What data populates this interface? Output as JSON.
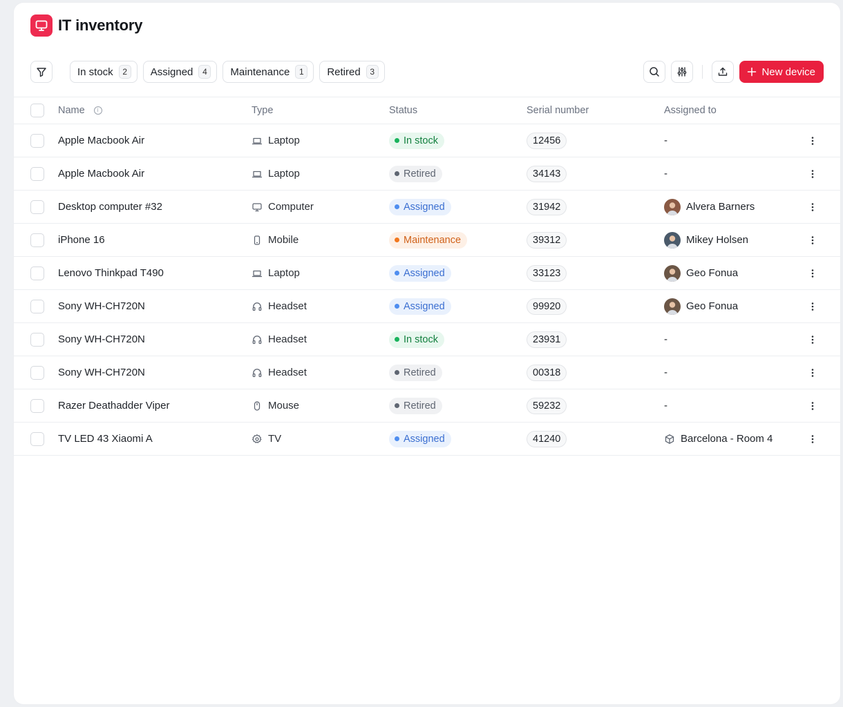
{
  "app": {
    "title": "IT inventory"
  },
  "filters": [
    {
      "label": "In stock",
      "count": "2"
    },
    {
      "label": "Assigned",
      "count": "4"
    },
    {
      "label": "Maintenance",
      "count": "1"
    },
    {
      "label": "Retired",
      "count": "3"
    }
  ],
  "toolbar": {
    "new_device_label": "New device"
  },
  "colors": {
    "accent": "#e9203f",
    "in_stock": {
      "bg": "#e7f7ee",
      "fg": "#13803f",
      "dot": "#19b35c"
    },
    "retired": {
      "bg": "#f0f1f3",
      "fg": "#5f6672",
      "dot": "#5f6672"
    },
    "assigned": {
      "bg": "#e9f1fd",
      "fg": "#3b6fd1",
      "dot": "#4f8ef0"
    },
    "maintenance": {
      "bg": "#fdf0e6",
      "fg": "#d0621a",
      "dot": "#f2781f"
    }
  },
  "table": {
    "columns": [
      "Name",
      "Type",
      "Status",
      "Serial number",
      "Assigned to"
    ],
    "rows": [
      {
        "name": "Apple Macbook Air",
        "type": "Laptop",
        "type_icon": "laptop-icon",
        "status": "In stock",
        "status_key": "in_stock",
        "serial": "12456",
        "assigned": "-",
        "assigned_kind": "none"
      },
      {
        "name": "Apple Macbook Air",
        "type": "Laptop",
        "type_icon": "laptop-icon",
        "status": "Retired",
        "status_key": "retired",
        "serial": "34143",
        "assigned": "-",
        "assigned_kind": "none"
      },
      {
        "name": "Desktop computer #32",
        "type": "Computer",
        "type_icon": "monitor-icon",
        "status": "Assigned",
        "status_key": "assigned",
        "serial": "31942",
        "assigned": "Alvera Barners",
        "assigned_kind": "person",
        "avatar_color": "#8a5a44"
      },
      {
        "name": "iPhone 16",
        "type": "Mobile",
        "type_icon": "mobile-icon",
        "status": "Maintenance",
        "status_key": "maintenance",
        "serial": "39312",
        "assigned": "Mikey Holsen",
        "assigned_kind": "person",
        "avatar_color": "#4a5a6a"
      },
      {
        "name": "Lenovo Thinkpad T490",
        "type": "Laptop",
        "type_icon": "laptop-icon",
        "status": "Assigned",
        "status_key": "assigned",
        "serial": "33123",
        "assigned": "Geo Fonua",
        "assigned_kind": "person",
        "avatar_color": "#6b5646"
      },
      {
        "name": "Sony WH-CH720N",
        "type": "Headset",
        "type_icon": "headset-icon",
        "status": "Assigned",
        "status_key": "assigned",
        "serial": "99920",
        "assigned": "Geo Fonua",
        "assigned_kind": "person",
        "avatar_color": "#6b5646"
      },
      {
        "name": "Sony WH-CH720N",
        "type": "Headset",
        "type_icon": "headset-icon",
        "status": "In stock",
        "status_key": "in_stock",
        "serial": "23931",
        "assigned": "-",
        "assigned_kind": "none"
      },
      {
        "name": "Sony WH-CH720N",
        "type": "Headset",
        "type_icon": "headset-icon",
        "status": "Retired",
        "status_key": "retired",
        "serial": "00318",
        "assigned": "-",
        "assigned_kind": "none"
      },
      {
        "name": "Razer Deathadder Viper",
        "type": "Mouse",
        "type_icon": "mouse-icon",
        "status": "Retired",
        "status_key": "retired",
        "serial": "59232",
        "assigned": "-",
        "assigned_kind": "none"
      },
      {
        "name": "TV LED 43 Xiaomi A",
        "type": "TV",
        "type_icon": "gear-icon",
        "status": "Assigned",
        "status_key": "assigned",
        "serial": "41240",
        "assigned": "Barcelona - Room 4",
        "assigned_kind": "place"
      }
    ]
  }
}
